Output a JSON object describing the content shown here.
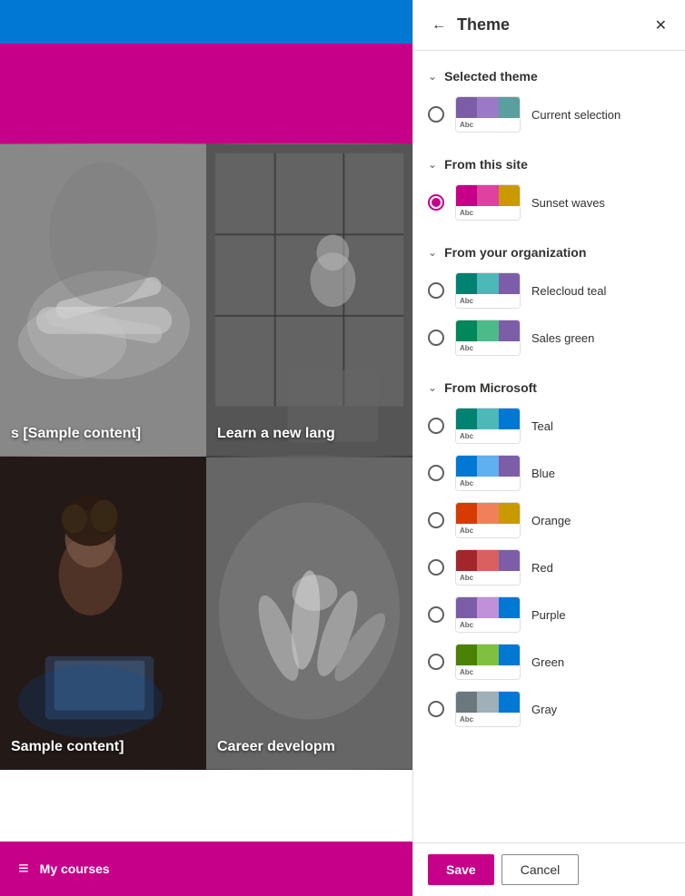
{
  "leftArea": {
    "topBarColor": "#0078d4",
    "pinkBarColor": "#c7008a",
    "gridCells": [
      {
        "label": "s [Sample content]",
        "type": "handshake"
      },
      {
        "label": "Learn a new lang",
        "type": "office"
      },
      {
        "label": "Sample content]",
        "type": "woman"
      },
      {
        "label": "Career developm",
        "type": "teamwork"
      }
    ],
    "bottomBar": {
      "icon": "≡",
      "label": "My courses"
    }
  },
  "themePanel": {
    "title": "Theme",
    "backLabel": "←",
    "closeLabel": "✕",
    "sections": [
      {
        "id": "selected-theme",
        "label": "Selected theme",
        "items": [
          {
            "id": "current-selection",
            "label": "Current selection",
            "selected": false,
            "swatchColors": [
              "#7b5ea7",
              "#9b79c7",
              "#5a9e9e"
            ]
          }
        ]
      },
      {
        "id": "from-this-site",
        "label": "From this site",
        "items": [
          {
            "id": "sunset-waves",
            "label": "Sunset waves",
            "selected": true,
            "swatchColors": [
              "#c7008a",
              "#e040a0",
              "#c89a00"
            ]
          }
        ]
      },
      {
        "id": "from-your-organization",
        "label": "From your organization",
        "items": [
          {
            "id": "relecloud-teal",
            "label": "Relecloud teal",
            "selected": false,
            "swatchColors": [
              "#008272",
              "#4db8b8",
              "#7b5ea7"
            ]
          },
          {
            "id": "sales-green",
            "label": "Sales green",
            "selected": false,
            "swatchColors": [
              "#00875a",
              "#4dba8a",
              "#7b5ea7"
            ]
          }
        ]
      },
      {
        "id": "from-microsoft",
        "label": "From Microsoft",
        "items": [
          {
            "id": "teal",
            "label": "Teal",
            "selected": false,
            "swatchColors": [
              "#008272",
              "#4db8b8",
              "#0078d4"
            ]
          },
          {
            "id": "blue",
            "label": "Blue",
            "selected": false,
            "swatchColors": [
              "#0078d4",
              "#60b0f0",
              "#7b5ea7"
            ]
          },
          {
            "id": "orange",
            "label": "Orange",
            "selected": false,
            "swatchColors": [
              "#d83b01",
              "#f0805a",
              "#c89a00"
            ]
          },
          {
            "id": "red",
            "label": "Red",
            "selected": false,
            "swatchColors": [
              "#a4262c",
              "#d86060",
              "#7b5ea7"
            ]
          },
          {
            "id": "purple",
            "label": "Purple",
            "selected": false,
            "swatchColors": [
              "#7b5ea7",
              "#c090d8",
              "#0078d4"
            ]
          },
          {
            "id": "green",
            "label": "Green",
            "selected": false,
            "swatchColors": [
              "#498205",
              "#80c040",
              "#0078d4"
            ]
          },
          {
            "id": "gray",
            "label": "Gray",
            "selected": false,
            "swatchColors": [
              "#69797e",
              "#a0b0b8",
              "#0078d4"
            ]
          }
        ]
      }
    ],
    "footer": {
      "saveLabel": "Save",
      "cancelLabel": "Cancel"
    }
  }
}
